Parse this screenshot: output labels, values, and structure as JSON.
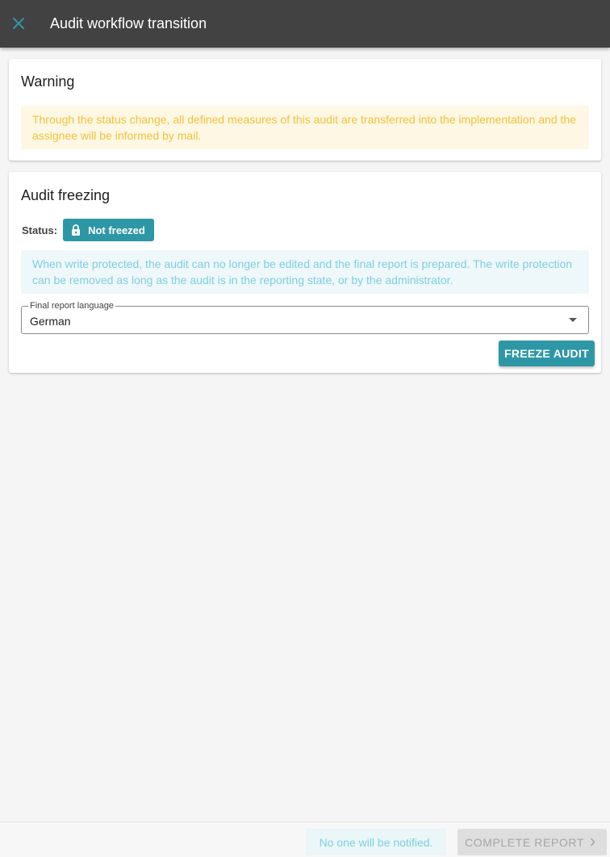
{
  "header": {
    "title": "Audit workflow transition",
    "close_icon": "close-icon",
    "accent_color": "#2e97a6"
  },
  "warning_card": {
    "title": "Warning",
    "message": "Through the status change, all defined measures of this audit are transferred into the implementation and the assignee will be informed by mail."
  },
  "freeze_card": {
    "title": "Audit freezing",
    "status_label": "Status:",
    "status_value": "Not freezed",
    "status_icon": "lock-icon",
    "info_message": "When write protected, the audit can no longer be edited and the final report is prepared. The write protection can be removed as long as the audit is in the reporting state, or by the administrator.",
    "language_select": {
      "label": "Final report language",
      "value": "German"
    },
    "freeze_button": "FREEZE AUDIT"
  },
  "footer": {
    "notification_text": "No one will be notified.",
    "complete_button": "COMPLETE REPORT",
    "complete_icon": "chevron-right-icon"
  }
}
